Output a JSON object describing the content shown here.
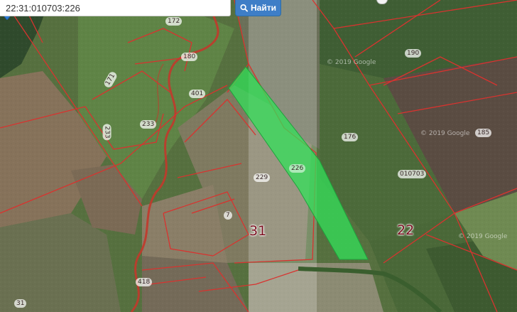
{
  "search": {
    "value": "22:31:010703:226",
    "button_label": "Найти",
    "button_icon": "search-icon"
  },
  "map": {
    "parcel_labels": [
      "172",
      "180",
      "171",
      "401",
      "233",
      "233",
      "190",
      "176",
      "185",
      "229",
      "010703",
      "7",
      "418",
      "31"
    ],
    "selected_parcel_label": "226",
    "quarter_labels": [
      "31",
      "22"
    ],
    "watermarks": [
      "© 2019 Google",
      "© 2019 Google",
      "© 2019 Google"
    ],
    "colors": {
      "boundary": "#d8332f",
      "selected_fill": "#33e05a",
      "marker": "#2f7ed8"
    }
  }
}
